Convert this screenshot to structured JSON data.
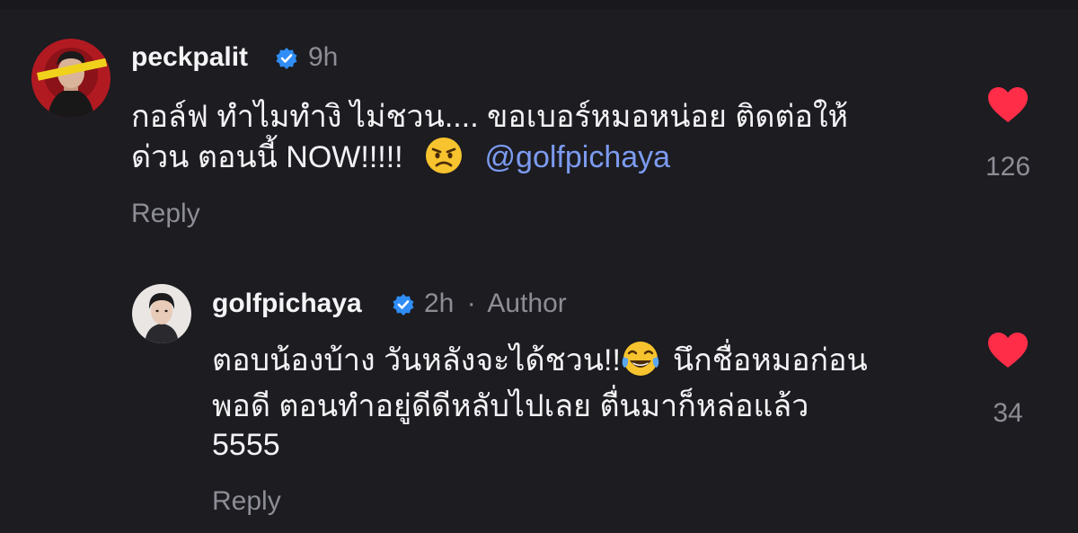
{
  "comments": [
    {
      "username": "peckpalit",
      "time": "9h",
      "line1": "กอล์ฟ ทำไมทำงิ ไม่ชวน.... ขอเบอร์หมอหน่อย ติดต่อให้",
      "line2_text": "ด่วน ตอนนี้ NOW!!!!!",
      "emoji_icon": "angry-face-emoji",
      "mention": "@golfpichaya",
      "reply_label": "Reply",
      "likes": "126"
    },
    {
      "username": "golfpichaya",
      "time": "2h",
      "separator": "·",
      "author_label": "Author",
      "line1_text": "ตอบน้องบ้าง วันหลังจะได้ชวน!!",
      "emoji_icon": "tears-of-joy-emoji",
      "line1_after": "นึกชื่อหมอก่อน",
      "line2": "พอดี ตอนทำอยู่ดีดีหลับไปเลย ตื่นมาก็หล่อแล้ว",
      "line3": "5555",
      "reply_label": "Reply",
      "likes": "34"
    }
  ],
  "colors": {
    "background": "#1c1c21",
    "text": "#f3f3f5",
    "muted": "#8d8d95",
    "mention": "#7c9bf0",
    "heart": "#ff2d47",
    "verified": "#2f8df5"
  }
}
